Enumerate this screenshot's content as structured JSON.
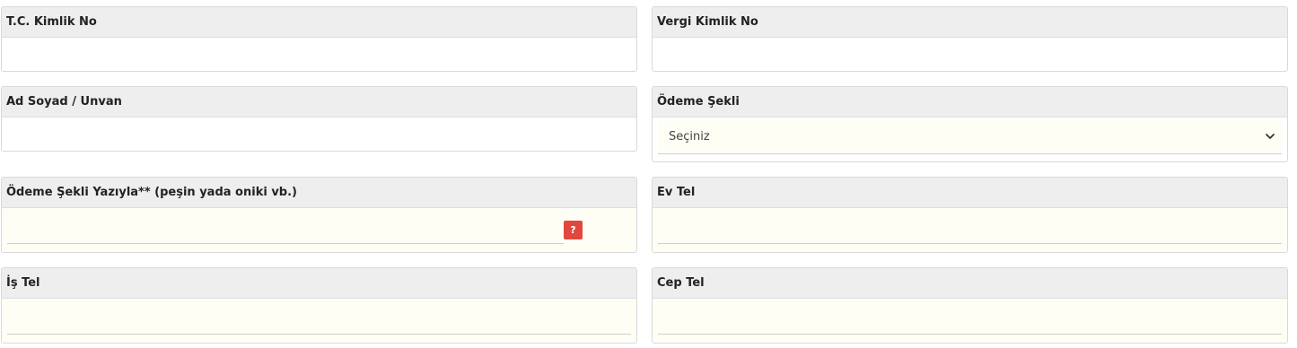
{
  "fields": {
    "tc_kimlik_no": {
      "label": "T.C. Kimlik No",
      "value": ""
    },
    "vergi_kimlik_no": {
      "label": "Vergi Kimlik No",
      "value": ""
    },
    "ad_soyad_unvan": {
      "label": "Ad Soyad / Unvan",
      "value": ""
    },
    "odeme_sekli": {
      "label": "Ödeme Şekli",
      "selected": "Seçiniz"
    },
    "odeme_sekli_yaziyla": {
      "label": "Ödeme Şekli Yazıyla** (peşin yada oniki vb.)",
      "value": "",
      "help_label": "?"
    },
    "ev_tel": {
      "label": "Ev Tel",
      "value": ""
    },
    "is_tel": {
      "label": "İş Tel",
      "value": ""
    },
    "cep_tel": {
      "label": "Cep Tel",
      "value": ""
    }
  },
  "colors": {
    "label_bg": "#eeeeee",
    "input_bg_highlight": "#fffef5",
    "help_button": "#e0483e"
  },
  "icons": {
    "select_arrow": "chevron-down-icon",
    "help": "question-icon"
  }
}
